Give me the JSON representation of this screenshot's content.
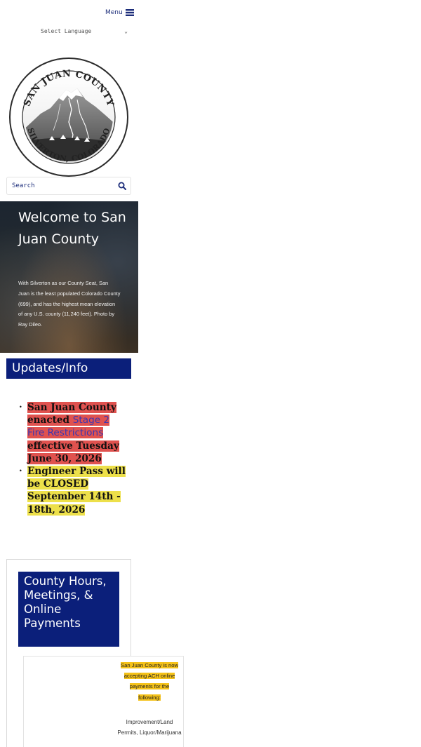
{
  "header": {
    "menu_label": "Menu",
    "language_select": "Select Language"
  },
  "seal": {
    "top_text": "SAN JUAN COUNTY",
    "bottom_text": "SILVERTON, COLORADO"
  },
  "search": {
    "placeholder": "Search"
  },
  "hero": {
    "title": "Welcome to San Juan County",
    "body": "With Silverton as our County Seat, San Juan is the least populated Colorado County (699), and has the highest mean elevation of any U.S. county (11,240 feet). Photo by Ray Dileo."
  },
  "updates": {
    "heading": "Updates/Info",
    "items": [
      {
        "prefix": "San Juan County enacted ",
        "link": "Stage 2 Fire Restrictions",
        "suffix": " effective Tuesday June 30, 2026"
      },
      {
        "text": "Engineer Pass will be CLOSED September 14th - 18th, 2026"
      }
    ]
  },
  "hours": {
    "title": "County Hours, Meetings, & Online Payments",
    "ach_notice": "San Juan County is now accepting ACH online payments for the following:",
    "ach_items_partial": "Improvement/Land Permits, Liquor/Marijuana"
  },
  "colors": {
    "navy": "#0b1f7a",
    "link": "#3a36b3",
    "highlight_red": "#e0524f",
    "highlight_yellow": "#ede04a",
    "highlight_gold": "#f5c218"
  }
}
